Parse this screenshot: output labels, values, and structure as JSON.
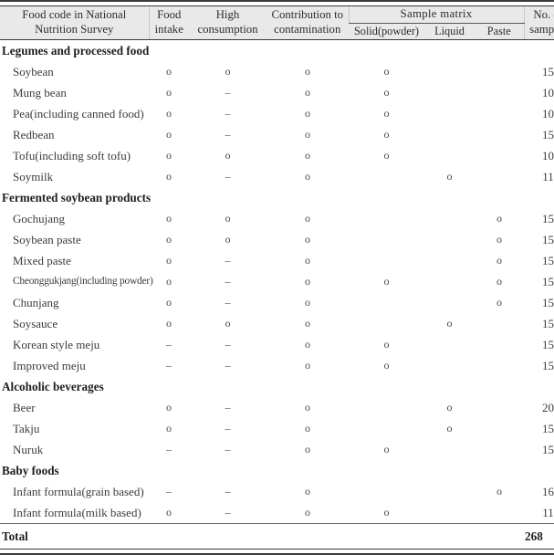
{
  "table": {
    "header": {
      "name": "Food code in National\nNutrition Survey",
      "name_line1": "Food code in National",
      "name_line2": "Nutrition Survey",
      "intake_line1": "Food",
      "intake_line2": "intake",
      "high_line1": "High",
      "high_line2": "consumption",
      "contrib_line1": "Contribution to",
      "contrib_line2": "contamination",
      "matrix_group": "Sample matrix",
      "matrix_solid": "Solid(powder)",
      "matrix_liquid": "Liquid",
      "matrix_paste": "Paste",
      "no_line1": "No. of",
      "no_line2": "samples"
    },
    "marks": {
      "yes": "o",
      "no": "–",
      "blank": ""
    },
    "rows": [
      {
        "type": "section",
        "name": "Legumes and processed food",
        "intake": "",
        "high": "",
        "contrib": "",
        "solid": "",
        "liquid": "",
        "paste": "",
        "samples": ""
      },
      {
        "type": "item",
        "name": "Soybean",
        "intake": "o",
        "high": "o",
        "contrib": "o",
        "solid": "o",
        "liquid": "",
        "paste": "",
        "samples": "15"
      },
      {
        "type": "item",
        "name": "Mung bean",
        "intake": "o",
        "high": "–",
        "contrib": "o",
        "solid": "o",
        "liquid": "",
        "paste": "",
        "samples": "10"
      },
      {
        "type": "item",
        "name": "Pea(including canned food)",
        "intake": "o",
        "high": "–",
        "contrib": "o",
        "solid": "o",
        "liquid": "",
        "paste": "",
        "samples": "10"
      },
      {
        "type": "item",
        "name": "Redbean",
        "intake": "o",
        "high": "–",
        "contrib": "o",
        "solid": "o",
        "liquid": "",
        "paste": "",
        "samples": "15"
      },
      {
        "type": "item",
        "name": "Tofu(including soft tofu)",
        "intake": "o",
        "high": "o",
        "contrib": "o",
        "solid": "o",
        "liquid": "",
        "paste": "",
        "samples": "10"
      },
      {
        "type": "item",
        "name": "Soymilk",
        "intake": "o",
        "high": "–",
        "contrib": "o",
        "solid": "",
        "liquid": "o",
        "paste": "",
        "samples": "11"
      },
      {
        "type": "section",
        "name": "Fermented soybean products",
        "intake": "",
        "high": "",
        "contrib": "",
        "solid": "",
        "liquid": "",
        "paste": "",
        "samples": ""
      },
      {
        "type": "item",
        "name": "Gochujang",
        "intake": "o",
        "high": "o",
        "contrib": "o",
        "solid": "",
        "liquid": "",
        "paste": "o",
        "samples": "15"
      },
      {
        "type": "item",
        "name": "Soybean paste",
        "intake": "o",
        "high": "o",
        "contrib": "o",
        "solid": "",
        "liquid": "",
        "paste": "o",
        "samples": "15"
      },
      {
        "type": "item",
        "name": "Mixed paste",
        "intake": "o",
        "high": "–",
        "contrib": "o",
        "solid": "",
        "liquid": "",
        "paste": "o",
        "samples": "15"
      },
      {
        "type": "item",
        "name": "Cheonggukjang(including powder)",
        "squeeze": true,
        "intake": "o",
        "high": "–",
        "contrib": "o",
        "solid": "o",
        "liquid": "",
        "paste": "o",
        "samples": "15"
      },
      {
        "type": "item",
        "name": "Chunjang",
        "intake": "o",
        "high": "–",
        "contrib": "o",
        "solid": "",
        "liquid": "",
        "paste": "o",
        "samples": "15"
      },
      {
        "type": "item",
        "name": "Soysauce",
        "intake": "o",
        "high": "o",
        "contrib": "o",
        "solid": "",
        "liquid": "o",
        "paste": "",
        "samples": "15"
      },
      {
        "type": "item",
        "name": "Korean style meju",
        "intake": "–",
        "high": "–",
        "contrib": "o",
        "solid": "o",
        "liquid": "",
        "paste": "",
        "samples": "15"
      },
      {
        "type": "item",
        "name": "Improved meju",
        "intake": "–",
        "high": "–",
        "contrib": "o",
        "solid": "o",
        "liquid": "",
        "paste": "",
        "samples": "15"
      },
      {
        "type": "section",
        "name": "Alcoholic beverages",
        "intake": "",
        "high": "",
        "contrib": "",
        "solid": "",
        "liquid": "",
        "paste": "",
        "samples": ""
      },
      {
        "type": "item",
        "name": "Beer",
        "intake": "o",
        "high": "–",
        "contrib": "o",
        "solid": "",
        "liquid": "o",
        "paste": "",
        "samples": "20"
      },
      {
        "type": "item",
        "name": "Takju",
        "intake": "o",
        "high": "–",
        "contrib": "o",
        "solid": "",
        "liquid": "o",
        "paste": "",
        "samples": "15"
      },
      {
        "type": "item",
        "name": "Nuruk",
        "intake": "–",
        "high": "–",
        "contrib": "o",
        "solid": "o",
        "liquid": "",
        "paste": "",
        "samples": "15"
      },
      {
        "type": "section",
        "name": "Baby foods",
        "intake": "",
        "high": "",
        "contrib": "",
        "solid": "",
        "liquid": "",
        "paste": "",
        "samples": ""
      },
      {
        "type": "item",
        "name": "Infant formula(grain based)",
        "intake": "–",
        "high": "–",
        "contrib": "o",
        "solid": "",
        "liquid": "",
        "paste": "o",
        "samples": "16"
      },
      {
        "type": "item",
        "name": "Infant formula(milk based)",
        "intake": "o",
        "high": "–",
        "contrib": "o",
        "solid": "o",
        "liquid": "",
        "paste": "",
        "samples": "11"
      }
    ],
    "total": {
      "label": "Total",
      "intake": "",
      "high": "",
      "contrib": "",
      "solid": "",
      "liquid": "",
      "paste": "",
      "samples": "268"
    }
  }
}
